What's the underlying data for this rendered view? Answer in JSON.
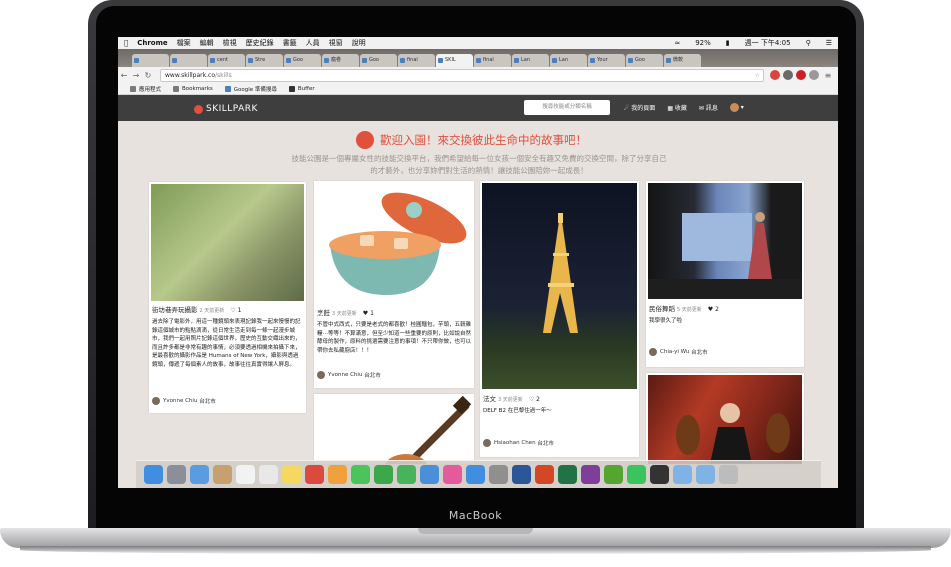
{
  "device": {
    "brand": "MacBook"
  },
  "menubar": {
    "app": "Chrome",
    "items": [
      "檔案",
      "編輯",
      "檢視",
      "歷史紀錄",
      "書籤",
      "人員",
      "視窗",
      "說明"
    ],
    "battery": "92%",
    "clock": "週一 下午4:05"
  },
  "browser": {
    "tabs": [
      "",
      "",
      "cent",
      "Stre",
      "Goo",
      "瘋卷",
      "Goo",
      "final",
      "SKIL",
      "final",
      "Lan",
      "Lan",
      "Your",
      "Goo",
      "微軟"
    ],
    "url_host": "www.skillpark.co",
    "url_path": "/skills",
    "bookmarks": [
      "應用程式",
      "Bookmarks",
      "Google 準備搜尋",
      "Buffer"
    ]
  },
  "site": {
    "logo": "SKILLPARK",
    "search_placeholder": "搜尋技能或分類名稱",
    "nav": {
      "my_page": "我的頁面",
      "favorites": "收藏",
      "messages": "訊息"
    },
    "welcome": "歡迎入園！來交換彼此生命中的故事吧！",
    "intro_line1": "技能公園是一個專屬女性的技能交換平台，我們希望給每一位女孩一個安全有趣又免費的交換空間，除了分享自己",
    "intro_line2": "的才藝外，也分享妳們對生活的熱情！讓技能公園陪妳一起成長！"
  },
  "cards": [
    {
      "title": "街坊巷弄玩攝影",
      "time": "2 天前更新",
      "hearts": "1",
      "desc": "過去除了電影外，用這一種鏡頭來表現記錄我一起來慢慢的記錄這個城市的點點滴滴，從日常生活走到每一條一起漫步城市，我們一起用照片記錄這個世界，歷史的互動交織出來的，而且許多都是非常有趣的事情，必須要透過相機來拍攝下來，是最喜歡的攝影作品是 Humans of New York，攝影與透過鏡頭，傳遞了每個素人的故事，故事往往真實得讓人屏息。",
      "user": "Yvonne Chiu",
      "city": "台北市"
    },
    {
      "title": "烹飪",
      "time": "3 天前更新",
      "hearts": "1",
      "desc": "不管中式西式，只要是老式的都喜歡！桂圓麵包，芋頭，五穀雜糧⋯等等！不算滿意，但至少知道一些重要的原則，比如說自然酵母的製作，原料的挑選需要注意的事項！不只帶你做，也可以帶你去私藏廚店！！！",
      "user": "Yvonne Chiu",
      "city": "台北市"
    },
    {
      "title": "法文",
      "time": "3 天前更新",
      "hearts": "2",
      "desc": "DELF B2 在巴黎住過一年～",
      "user": "Hsiaohan Chen",
      "city": "台北市"
    },
    {
      "title": "民俗舞蹈",
      "time": "5 天前更新",
      "hearts": "2",
      "desc": "我學很久了啦",
      "user": "Chia-yi Wu",
      "city": "台北市"
    }
  ],
  "colors": {
    "accent": "#e0503d",
    "nav_bg": "#3e3e3e",
    "page_bg": "#e7e2de"
  },
  "dock_apps": [
    "finder-icon",
    "launchpad-icon",
    "preview-icon",
    "contacts-icon",
    "calendar-icon",
    "reminders-icon",
    "notes-icon",
    "chrome-icon",
    "photos-icon",
    "messages-icon",
    "facetime-icon",
    "numbers-icon",
    "keynote-icon",
    "itunes-icon",
    "app-store-icon",
    "system-preferences-icon",
    "word-icon",
    "powerpoint-icon",
    "excel-icon",
    "onenote-icon",
    "evernote-icon",
    "line-icon",
    "terminal-icon",
    "folder-icon",
    "downloads-icon",
    "trash-icon"
  ]
}
